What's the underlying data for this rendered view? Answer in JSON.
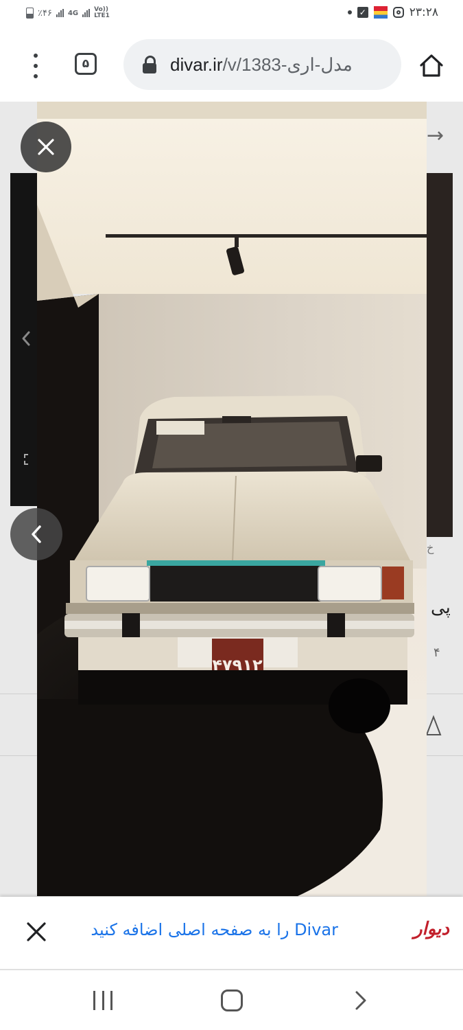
{
  "status_bar": {
    "battery": "٪۴۶",
    "network_4g": "4G",
    "volte": "Vo)) LTE1",
    "time": "۲۳:۲۸"
  },
  "browser": {
    "tab_count": "۵",
    "url_host": "divar.ir",
    "url_path": "/v/1383-مدل-اری",
    "icons": [
      "menu-icon",
      "lock-icon",
      "home-icon"
    ]
  },
  "viewer": {
    "close_label": "×",
    "license_plate": "۴۷۹۱۲"
  },
  "install_banner": {
    "text": "Divar را به صفحه اصلی اضافه کنید",
    "logo": "دیوار",
    "close_label": "×"
  },
  "background_page": {
    "text_fragment": "پی",
    "number_fragment": "۴",
    "letter_fragment": "خ"
  }
}
